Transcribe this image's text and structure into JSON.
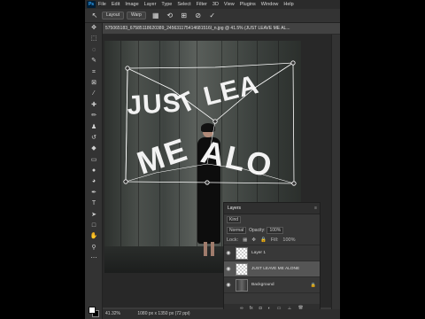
{
  "menubar": {
    "logo": "Ps",
    "items": [
      "File",
      "Edit",
      "Image",
      "Layer",
      "Type",
      "Select",
      "Filter",
      "3D",
      "View",
      "Plugins",
      "Window",
      "Help"
    ]
  },
  "options": {
    "layout_label": "Layout",
    "warp_label": "Warp",
    "icons": [
      "grid-icon",
      "rotate-icon",
      "split-icon",
      "cancel-icon",
      "commit-icon"
    ]
  },
  "document": {
    "tab_title": "575065183_67585118620389_245631175414681516l_n.jpg @ 41.5% (JUST LEAVE ME AL..."
  },
  "canvas": {
    "warp_text_line1": "JUST LEAVE",
    "warp_text_line2": "ME ALONE"
  },
  "status": {
    "zoom": "41.32%",
    "dimensions": "1080 px x 1350 px (72 ppi)"
  },
  "layers_panel": {
    "title": "Layers",
    "kind": "Kind",
    "blend_mode": "Normal",
    "opacity_label": "Opacity:",
    "opacity_value": "100%",
    "lock_label": "Lock:",
    "fill_label": "Fill:",
    "fill_value": "100%",
    "layers": [
      {
        "name": "Layer 1",
        "visible": true,
        "active": false
      },
      {
        "name": "JUST LEAVE ME ALONE",
        "visible": true,
        "active": true
      },
      {
        "name": "Background",
        "visible": true,
        "active": false,
        "locked": true
      }
    ]
  },
  "colors": {
    "accent": "#31a8ff",
    "panel": "#383838",
    "menubar": "#2b2b2b"
  }
}
